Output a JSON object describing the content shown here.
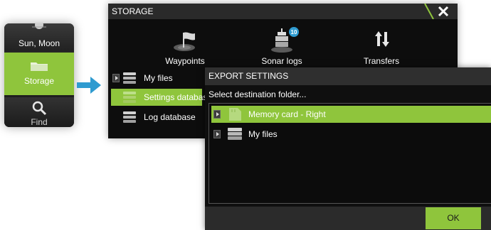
{
  "colors": {
    "accent_green": "#8fc53c",
    "arrow_blue": "#2f9bd0",
    "dark_bg": "#0d0d0d"
  },
  "mini_menu": {
    "items": [
      {
        "label": "Sun, Moon",
        "icon": "sun-moon-icon"
      },
      {
        "label": "Storage",
        "icon": "folder-icon",
        "selected": true
      },
      {
        "label": "Find",
        "icon": "magnifier-icon"
      }
    ]
  },
  "storage": {
    "title": "STORAGE",
    "tiles": [
      {
        "label": "Waypoints",
        "icon": "waypoint-flag-icon"
      },
      {
        "label": "Sonar logs",
        "icon": "sonar-logs-icon",
        "badge": "10"
      },
      {
        "label": "Transfers",
        "icon": "transfers-icon"
      }
    ],
    "files": [
      {
        "label": "My files",
        "icon": "database-icon"
      },
      {
        "label": "Settings database",
        "icon": "database-icon",
        "selected": true
      },
      {
        "label": "Log database",
        "icon": "database-icon"
      }
    ]
  },
  "export_dialog": {
    "title": "EXPORT SETTINGS",
    "subtitle": "Select destination folder...",
    "destinations": [
      {
        "label": "Memory card - Right",
        "icon": "memory-card-icon",
        "selected": true
      },
      {
        "label": "My files",
        "icon": "database-icon"
      }
    ],
    "ok_label": "OK"
  }
}
